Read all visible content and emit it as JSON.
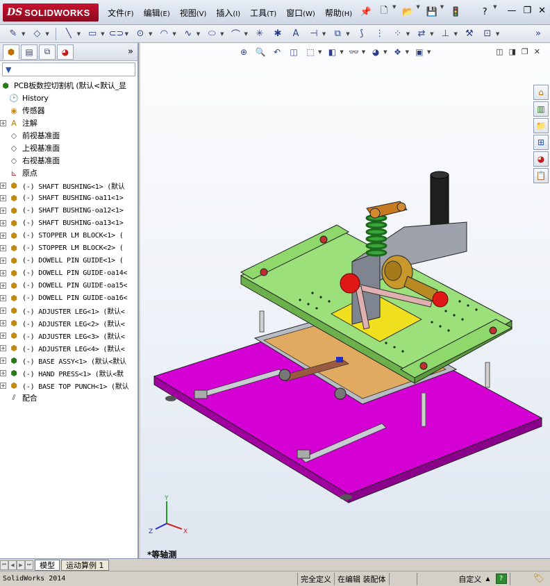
{
  "app": {
    "logo_ds": "DS",
    "logo_text": "SOLIDWORKS"
  },
  "menus": [
    {
      "label": "文件",
      "accel": "(F)"
    },
    {
      "label": "编辑",
      "accel": "(E)"
    },
    {
      "label": "视图",
      "accel": "(V)"
    },
    {
      "label": "插入",
      "accel": "(I)"
    },
    {
      "label": "工具",
      "accel": "(T)"
    },
    {
      "label": "窗口",
      "accel": "(W)"
    },
    {
      "label": "帮助",
      "accel": "(H)"
    }
  ],
  "quick_access": {
    "pin": "📌",
    "new": "🗋",
    "open": "📂",
    "save": "💾",
    "traffic": "🚦",
    "help": "?"
  },
  "window_controls": {
    "minimize": "—",
    "restore": "❐",
    "close": "✕"
  },
  "toolbar_icons": {
    "sketch": "✎",
    "smart_dim": "◇",
    "line": "╲",
    "rectangle": "▭",
    "slot": "⊂⊃",
    "circle": "⊙",
    "arc": "◠",
    "spline": "∿",
    "ellipse": "⬭",
    "fillet": "⌒",
    "point": "✳",
    "centerline": "✱",
    "text": "A",
    "trim": "⊣",
    "convert": "⧉",
    "offset": "⟆",
    "mirror": "⋮",
    "pattern": "⁘",
    "move": "⇄",
    "relations": "⊥",
    "repair": "⚒",
    "quick_snap": "⊡",
    "more": "»"
  },
  "featuremanager": {
    "tabs": [
      "tree",
      "property",
      "config",
      "display"
    ],
    "more": "»",
    "filter_icon": "▼",
    "root_label": "PCB板数控切割机  (默认<默认_显",
    "items": [
      {
        "label": "History",
        "icon": "history",
        "expand": false
      },
      {
        "label": "传感器",
        "icon": "sensor",
        "expand": false
      },
      {
        "label": "注解",
        "icon": "annotation",
        "expand": true
      },
      {
        "label": "前视基准面",
        "icon": "plane",
        "expand": false
      },
      {
        "label": "上视基准面",
        "icon": "plane",
        "expand": false
      },
      {
        "label": "右视基准面",
        "icon": "plane",
        "expand": false
      },
      {
        "label": "原点",
        "icon": "origin",
        "expand": false
      },
      {
        "label": "(-) SHAFT BUSHING<1> (默认",
        "icon": "part",
        "expand": true
      },
      {
        "label": "(-) SHAFT BUSHING-oa11<1>",
        "icon": "part",
        "expand": true
      },
      {
        "label": "(-) SHAFT BUSHING-oa12<1>",
        "icon": "part",
        "expand": true
      },
      {
        "label": "(-) SHAFT BUSHING-oa13<1>",
        "icon": "part",
        "expand": true
      },
      {
        "label": "(-) STOPPER LM BLOCK<1> (",
        "icon": "part",
        "expand": true
      },
      {
        "label": "(-) STOPPER LM BLOCK<2> (",
        "icon": "part",
        "expand": true
      },
      {
        "label": "(-) DOWELL PIN GUIDE<1> (",
        "icon": "part",
        "expand": true
      },
      {
        "label": "(-) DOWELL PIN GUIDE-oa14<",
        "icon": "part",
        "expand": true
      },
      {
        "label": "(-) DOWELL PIN GUIDE-oa15<",
        "icon": "part",
        "expand": true
      },
      {
        "label": "(-) DOWELL PIN GUIDE-oa16<",
        "icon": "part",
        "expand": true
      },
      {
        "label": "(-) ADJUSTER LEG<1> (默认<",
        "icon": "part",
        "expand": true
      },
      {
        "label": "(-) ADJUSTER LEG<2> (默认<",
        "icon": "part",
        "expand": true
      },
      {
        "label": "(-) ADJUSTER LEG<3> (默认<",
        "icon": "part",
        "expand": true
      },
      {
        "label": "(-) ADJUSTER LEG<4> (默认<",
        "icon": "part",
        "expand": true
      },
      {
        "label": "(-) BASE ASSY<1> (默认<默认",
        "icon": "assembly",
        "expand": true
      },
      {
        "label": "(-) HAND PRESS<1> (默认<默",
        "icon": "assembly",
        "expand": true
      },
      {
        "label": "(-) BASE TOP PUNCH<1> (默认",
        "icon": "part",
        "expand": true
      },
      {
        "label": "配合",
        "icon": "mates",
        "expand": false
      }
    ]
  },
  "headsup_icons": {
    "zoom_fit": "⊕",
    "zoom_area": "🔍",
    "prev_view": "↶",
    "section": "◫",
    "view_orient": "⬚",
    "display_style": "◧",
    "hide_show": "👓",
    "appearance": "◕",
    "scene": "❖",
    "view_settings": "▣"
  },
  "gfx_window_controls": {
    "tile_h": "◫",
    "tile_v": "◨",
    "restore": "❐",
    "close": "✕"
  },
  "task_pane": {
    "home": "⌂",
    "resources": "▥",
    "library": "📁",
    "explorer": "⊞",
    "appearances": "◕",
    "properties": "📋"
  },
  "triad": {
    "x": "X",
    "y": "Y",
    "z": "Z"
  },
  "view_name": "*等轴测",
  "bottom_tabs": [
    {
      "label": "模型",
      "active": true
    },
    {
      "label": "运动算例 1",
      "active": false
    }
  ],
  "status": {
    "app_version": "SolidWorks 2014",
    "fully_defined": "完全定义",
    "editing": "在编辑 装配体",
    "custom": "自定义",
    "help": "?"
  }
}
